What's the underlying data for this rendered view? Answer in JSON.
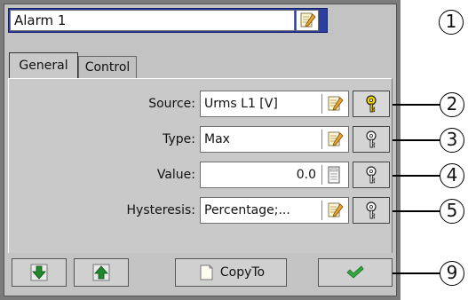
{
  "window": {
    "title_value": "Alarm 1",
    "tabs": [
      {
        "label": "General",
        "active": true
      },
      {
        "label": "Control",
        "active": false
      }
    ]
  },
  "fields": [
    {
      "label": "Source:",
      "value": "Urms L1 [V]",
      "button_icon": "edit-icon",
      "help_icon": "help-key-icon",
      "help_highlight": true
    },
    {
      "label": "Type:",
      "value": "Max",
      "button_icon": "edit-icon",
      "help_icon": "help-key-icon",
      "help_highlight": false
    },
    {
      "label": "Value:",
      "value": "0.0",
      "button_icon": "calculator-icon",
      "help_icon": "help-key-icon",
      "help_highlight": false
    },
    {
      "label": "Hysteresis:",
      "value": "Percentage;...",
      "button_icon": "edit-icon",
      "help_icon": "help-key-icon",
      "help_highlight": false
    }
  ],
  "toolbar": {
    "down_icon": "arrow-down-icon",
    "up_icon": "arrow-up-icon",
    "copyto_label": "CopyTo",
    "ok_icon": "checkmark-icon"
  },
  "callouts": [
    "1",
    "2",
    "3",
    "4",
    "5",
    "9"
  ],
  "colors": {
    "title_bar": "#2d3ea1",
    "panel": "#c3c3c3",
    "arrow_green": "#1f8a2c",
    "check_green": "#2faa3a",
    "help_yellow": "#f2d400"
  }
}
